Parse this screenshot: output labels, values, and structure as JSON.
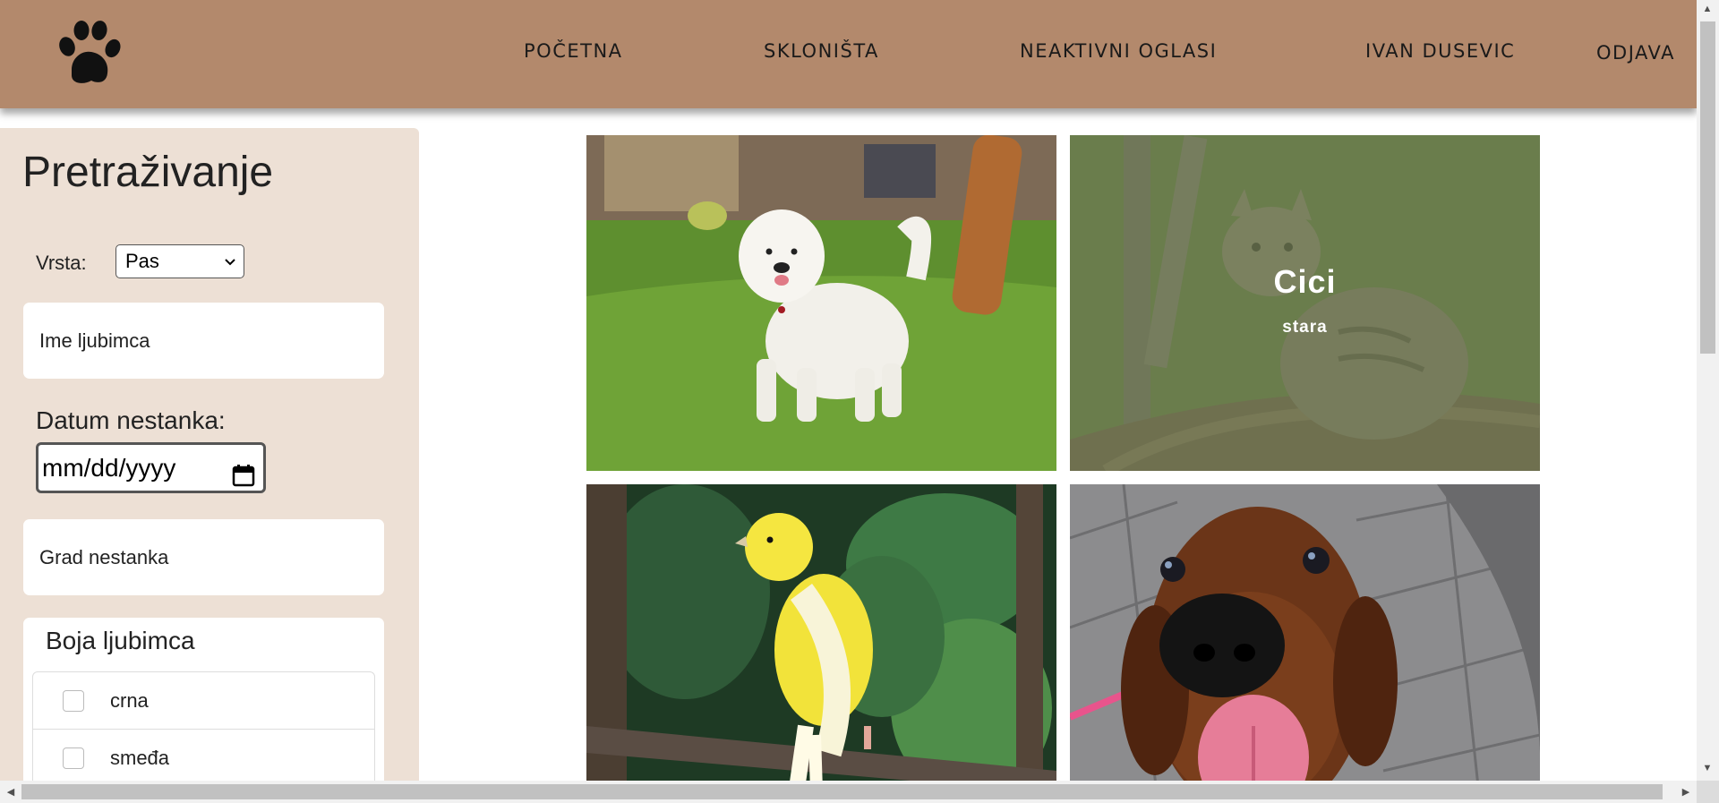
{
  "nav": {
    "items": [
      {
        "label": "POČETNA"
      },
      {
        "label": "SKLONIŠTA"
      },
      {
        "label": "NEAKTIVNI OGLASI"
      },
      {
        "label": "IVAN DUSEVIC"
      },
      {
        "label": "ODJAVA"
      }
    ],
    "logo_icon": "paw-icon"
  },
  "sidebar": {
    "title": "Pretraživanje",
    "vrsta_label": "Vrsta:",
    "vrsta_value": "Pas",
    "name_field": "Ime ljubimca",
    "datum_label": "Datum nestanka:",
    "datum_placeholder": "mm/dd/yyyy",
    "grad_field": "Grad nestanka",
    "boja_title": "Boja ljubimca",
    "boja_options": [
      {
        "label": "crna",
        "checked": false
      },
      {
        "label": "smeđa",
        "checked": false
      }
    ]
  },
  "cards": [
    {
      "photo": "white-dog",
      "hover": false
    },
    {
      "photo": "tabby-cat",
      "hover": true,
      "name": "Cici",
      "subtitle": "stara"
    },
    {
      "photo": "yellow-canary",
      "hover": false
    },
    {
      "photo": "brown-dachshund",
      "hover": false
    }
  ],
  "colors": {
    "header_bg": "#b3896c",
    "sidebar_bg": "#ede0d5",
    "overlay": "#73825599"
  }
}
